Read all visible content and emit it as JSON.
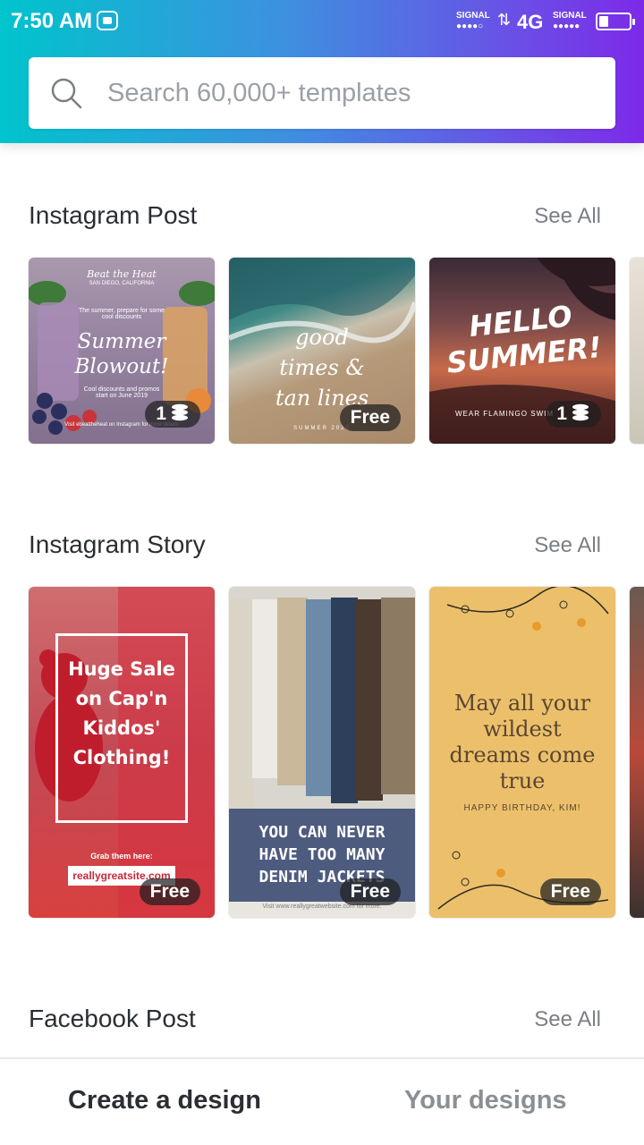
{
  "status_bar": {
    "time": "7:50 AM",
    "signal_label_1": "SIGNAL",
    "signal_label_2": "SIGNAL",
    "network": "4G"
  },
  "search": {
    "placeholder": "Search 60,000+ templates"
  },
  "sections": [
    {
      "title": "Instagram Post",
      "see_all": "See All",
      "cards": [
        {
          "badge": "1",
          "line1": "Beat the Heat",
          "line2": "SAN DIEGO, CALIFORNIA",
          "line3": "The summer, prepare for some cool discounts",
          "headline": "Summer Blowout!",
          "line4": "Cool discounts and promos start on June 2019",
          "footer": "Visit ebeattheheat on Instagram for more details"
        },
        {
          "badge": "Free",
          "headline": "good times & tan lines",
          "footer": "SUMMER 2020"
        },
        {
          "badge": "1",
          "headline": "HELLO SUMMER!",
          "footer": "WEAR FLAMINGO SWIM"
        }
      ]
    },
    {
      "title": "Instagram Story",
      "see_all": "See All",
      "cards": [
        {
          "badge": "Free",
          "headline": "Huge Sale on Cap'n Kiddos' Clothing!",
          "grab": "Grab them here:",
          "url": "reallygreatsite.com"
        },
        {
          "badge": "Free",
          "headline": "YOU CAN NEVER HAVE TOO MANY DENIM JACKETS",
          "footer": "Visit www.reallygreatwebsite.com for more."
        },
        {
          "badge": "Free",
          "headline": "May all your wildest dreams come true",
          "sub": "HAPPY BIRTHDAY, KIM!"
        }
      ]
    },
    {
      "title": "Facebook Post",
      "see_all": "See All"
    }
  ],
  "bottom_nav": {
    "create": "Create a design",
    "yours": "Your designs"
  },
  "colors": {
    "gradient_start": "#00c4cc",
    "gradient_end": "#7d2ae8",
    "active_tab": "#2b2f33",
    "inactive_tab": "#8a8f94"
  }
}
